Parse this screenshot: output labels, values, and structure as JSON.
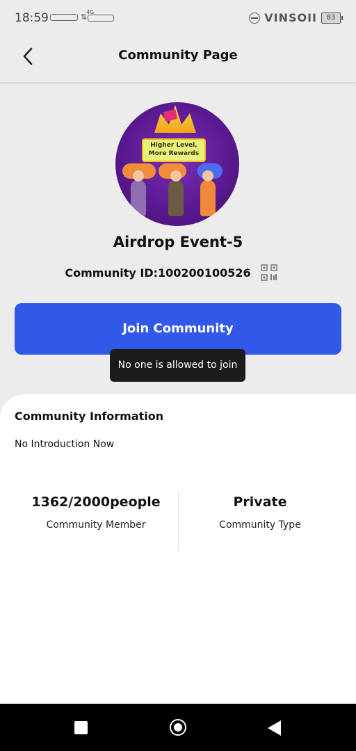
{
  "status_bar": {
    "time": "18:59",
    "network": "4G",
    "carrier": "VINSOII",
    "battery": "83"
  },
  "header": {
    "title": "Community Page",
    "back_icon": "chevron-left-icon"
  },
  "community": {
    "avatar_text": "Higher Level, More Rewards",
    "name": "Airdrop Event-5",
    "id_label": "Community ID:100200100526",
    "qr_icon": "qr-code-icon"
  },
  "join": {
    "button_label": "Join Community",
    "tooltip": "No one is allowed to join"
  },
  "info": {
    "title": "Community Information",
    "introduction": "No Introduction Now",
    "members_value": "1362/2000people",
    "members_label": "Community Member",
    "type_value": "Private",
    "type_label": "Community Type"
  },
  "nav": {
    "recents_icon": "square-icon",
    "home_icon": "circle-home-icon",
    "back_icon": "triangle-back-icon"
  },
  "colors": {
    "accent": "#3158e8",
    "background": "#ececec",
    "card": "#ffffff",
    "tooltip": "#1b1b1b"
  }
}
